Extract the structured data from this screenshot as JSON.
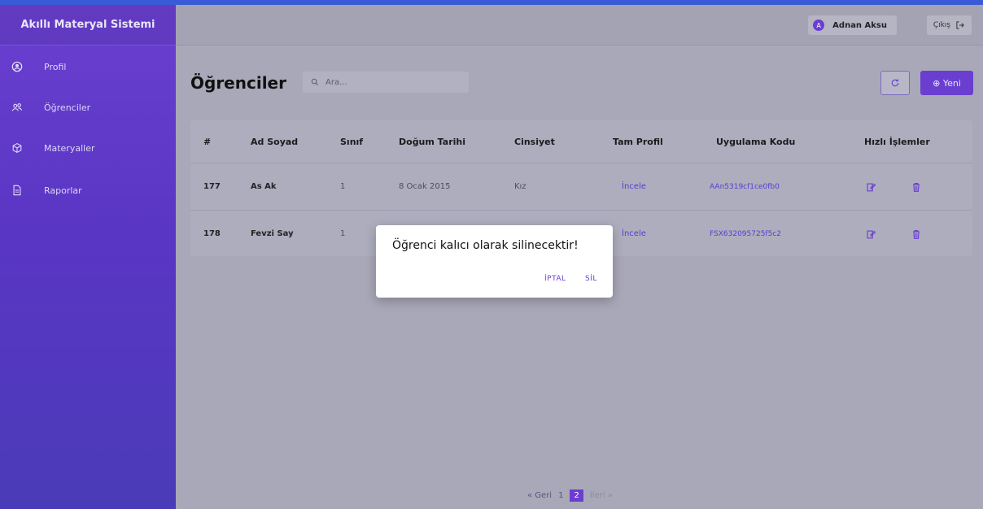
{
  "app": {
    "title": "Akıllı Materyal Sistemi"
  },
  "sidebar": {
    "items": [
      {
        "label": "Profil",
        "icon": "user-circle-icon"
      },
      {
        "label": "Öğrenciler",
        "icon": "users-icon"
      },
      {
        "label": "Materyaller",
        "icon": "cube-icon"
      },
      {
        "label": "Raporlar",
        "icon": "document-icon"
      }
    ]
  },
  "topbar": {
    "user_initial": "A",
    "user_name": "Adnan Aksu",
    "logout_label": "Çıkış"
  },
  "main": {
    "title": "Öğrenciler",
    "search_placeholder": "Ara...",
    "new_label": "⊕ Yeni"
  },
  "table": {
    "headers": [
      "#",
      "Ad Soyad",
      "Sınıf",
      "Doğum Tarihi",
      "Cinsiyet",
      "Tam Profil",
      "Uygulama Kodu",
      "Hızlı İşlemler"
    ],
    "rows": [
      {
        "id": "177",
        "name": "As Ak",
        "class": "1",
        "birth": "8 Ocak 2015",
        "gender": "Kız",
        "profile": "İncele",
        "code": "AAn5319cf1ce0fb0"
      },
      {
        "id": "178",
        "name": "Fevzi Say",
        "class": "1",
        "birth": "",
        "gender": "",
        "profile": "İncele",
        "code": "FSX632095725f5c2"
      }
    ]
  },
  "dialog": {
    "message": "Öğrenci kalıcı olarak silinecektir!",
    "cancel_label": "İPTAL",
    "confirm_label": "SİL"
  },
  "pagination": {
    "prev": "« Geri",
    "pages": [
      "1",
      "2"
    ],
    "current": "2",
    "next": "İleri »"
  },
  "colors": {
    "accent": "#6a3fd0",
    "link": "#5a3bd0",
    "topline": "#3a5bd6"
  }
}
